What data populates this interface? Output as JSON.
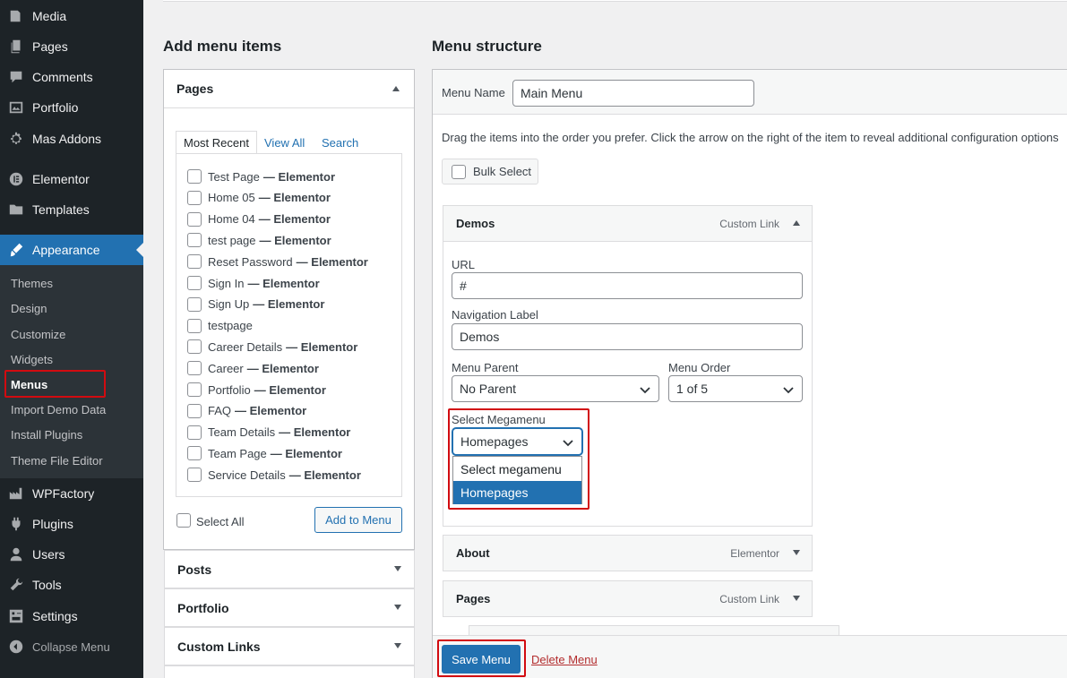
{
  "sidebar": {
    "items": [
      {
        "label": "Media",
        "icon": "media-icon"
      },
      {
        "label": "Pages",
        "icon": "pages-icon"
      },
      {
        "label": "Comments",
        "icon": "comments-icon"
      },
      {
        "label": "Portfolio",
        "icon": "portfolio-icon"
      },
      {
        "label": "Mas Addons",
        "icon": "gear-icon"
      },
      {
        "label": "Elementor",
        "icon": "elementor-icon"
      },
      {
        "label": "Templates",
        "icon": "folder-icon"
      },
      {
        "label": "Appearance",
        "icon": "brush-icon"
      },
      {
        "label": "WPFactory",
        "icon": "factory-icon"
      },
      {
        "label": "Plugins",
        "icon": "plugin-icon"
      },
      {
        "label": "Users",
        "icon": "user-icon"
      },
      {
        "label": "Tools",
        "icon": "wrench-icon"
      },
      {
        "label": "Settings",
        "icon": "settings-icon"
      },
      {
        "label": "Collapse Menu",
        "icon": "collapse-icon"
      }
    ],
    "submenu": [
      "Themes",
      "Design",
      "Customize",
      "Widgets",
      "Menus",
      "Import Demo Data",
      "Install Plugins",
      "Theme File Editor"
    ]
  },
  "add_items": {
    "heading": "Add menu items",
    "pages_title": "Pages",
    "tabs": [
      "Most Recent",
      "View All",
      "Search"
    ],
    "pages": [
      {
        "name": "Test Page",
        "suffix": "— Elementor"
      },
      {
        "name": "Home 05",
        "suffix": "— Elementor"
      },
      {
        "name": "Home 04",
        "suffix": "— Elementor"
      },
      {
        "name": "test page",
        "suffix": "— Elementor"
      },
      {
        "name": "Reset Password",
        "suffix": "— Elementor"
      },
      {
        "name": "Sign In",
        "suffix": "— Elementor"
      },
      {
        "name": "Sign Up",
        "suffix": "— Elementor"
      },
      {
        "name": "testpage",
        "suffix": ""
      },
      {
        "name": "Career Details",
        "suffix": "— Elementor"
      },
      {
        "name": "Career",
        "suffix": "— Elementor"
      },
      {
        "name": "Portfolio",
        "suffix": "— Elementor"
      },
      {
        "name": "FAQ",
        "suffix": "— Elementor"
      },
      {
        "name": "Team Details",
        "suffix": "— Elementor"
      },
      {
        "name": "Team Page",
        "suffix": "— Elementor"
      },
      {
        "name": "Service Details",
        "suffix": "— Elementor"
      }
    ],
    "select_all": "Select All",
    "add_button": "Add to Menu",
    "sections": [
      "Posts",
      "Portfolio",
      "Custom Links"
    ]
  },
  "structure": {
    "heading": "Menu structure",
    "menu_name_label": "Menu Name",
    "menu_name_value": "Main Menu",
    "instructions": "Drag the items into the order you prefer. Click the arrow on the right of the item to reveal additional configuration options",
    "bulk_select": "Bulk Select",
    "demos": {
      "title": "Demos",
      "type": "Custom Link",
      "url_label": "URL",
      "url_value": "#",
      "nav_label": "Navigation Label",
      "nav_value": "Demos",
      "parent_label": "Menu Parent",
      "parent_value": "No Parent",
      "order_label": "Menu Order",
      "order_value": "1 of 5",
      "mega_label": "Select Megamenu",
      "mega_value": "Homepages",
      "mega_options": [
        "Select megamenu",
        "Homepages"
      ]
    },
    "items": [
      {
        "title": "About",
        "type": "Elementor"
      },
      {
        "title": "Pages",
        "type": "Custom Link"
      }
    ],
    "save_button": "Save Menu",
    "delete_link": "Delete Menu"
  },
  "colors": {
    "accent": "#2271b1",
    "highlight": "#d20b10",
    "sidebar": "#1d2327"
  }
}
